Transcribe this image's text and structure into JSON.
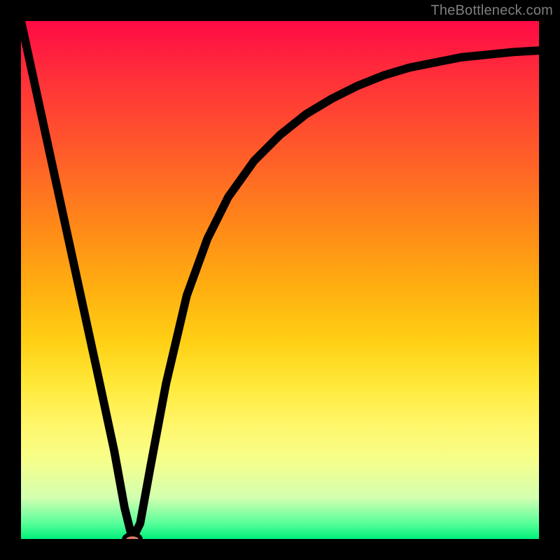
{
  "watermark": "TheBottleneck.com",
  "chart_data": {
    "type": "line",
    "title": "",
    "xlabel": "",
    "ylabel": "",
    "xlim": [
      0,
      100
    ],
    "ylim": [
      0,
      100
    ],
    "grid": false,
    "legend": false,
    "series": [
      {
        "name": "bottleneck-curve",
        "x": [
          0,
          5,
          10,
          15,
          18,
          20,
          21.5,
          23,
          25,
          28,
          32,
          36,
          40,
          45,
          50,
          55,
          60,
          65,
          70,
          75,
          80,
          85,
          90,
          95,
          100
        ],
        "y": [
          100,
          77,
          54,
          31,
          17,
          6,
          0,
          3,
          14,
          30,
          47,
          58,
          66,
          73,
          78,
          82,
          85,
          87.5,
          89.5,
          91,
          92,
          93,
          93.5,
          94,
          94.3
        ]
      }
    ],
    "marker": {
      "x": 21.5,
      "y": 0,
      "rx": 1.6,
      "ry": 0.9,
      "color": "#d87a66"
    },
    "background_gradient": {
      "stops": [
        {
          "pct": 0,
          "color": "#ff0a45"
        },
        {
          "pct": 25,
          "color": "#ff5a2a"
        },
        {
          "pct": 50,
          "color": "#ffb010"
        },
        {
          "pct": 75,
          "color": "#fff66a"
        },
        {
          "pct": 97,
          "color": "#58ff9a"
        },
        {
          "pct": 100,
          "color": "#00f07a"
        }
      ]
    }
  }
}
